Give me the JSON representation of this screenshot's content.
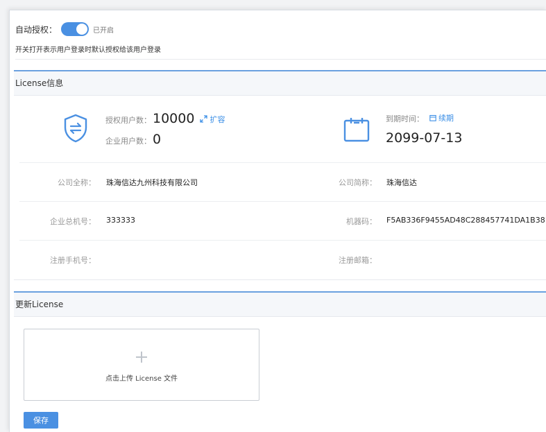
{
  "auto_auth": {
    "label": "自动授权：",
    "switch_state_text": "已开启",
    "description": "开关打开表示用户登录时默认授权给该用户登录"
  },
  "license_panel": {
    "title": "License信息",
    "authorized_users": {
      "label": "授权用户数：",
      "value": "10000",
      "link": "扩容"
    },
    "enterprise_users": {
      "label": "企业用户数：",
      "value": "0"
    },
    "expiry": {
      "label": "到期时间：",
      "link": "续期",
      "value": "2099-07-13"
    },
    "rows": [
      {
        "left_key": "公司全称：",
        "left_value": "珠海信达九州科技有限公司",
        "right_key": "公司简称：",
        "right_value": "珠海信达"
      },
      {
        "left_key": "企业总机号：",
        "left_value": "333333",
        "right_key": "机器码：",
        "right_value": "F5AB336F9455AD48C288457741DA1B38"
      },
      {
        "left_key": "注册手机号：",
        "left_value": "",
        "right_key": "注册邮箱：",
        "right_value": ""
      }
    ]
  },
  "update_panel": {
    "title": "更新License",
    "upload_text": "点击上传 License 文件",
    "save_label": "保存"
  },
  "colors": {
    "accent": "#4a90e2",
    "link": "#3a8ee6",
    "panel_border": "#6aa0df"
  }
}
